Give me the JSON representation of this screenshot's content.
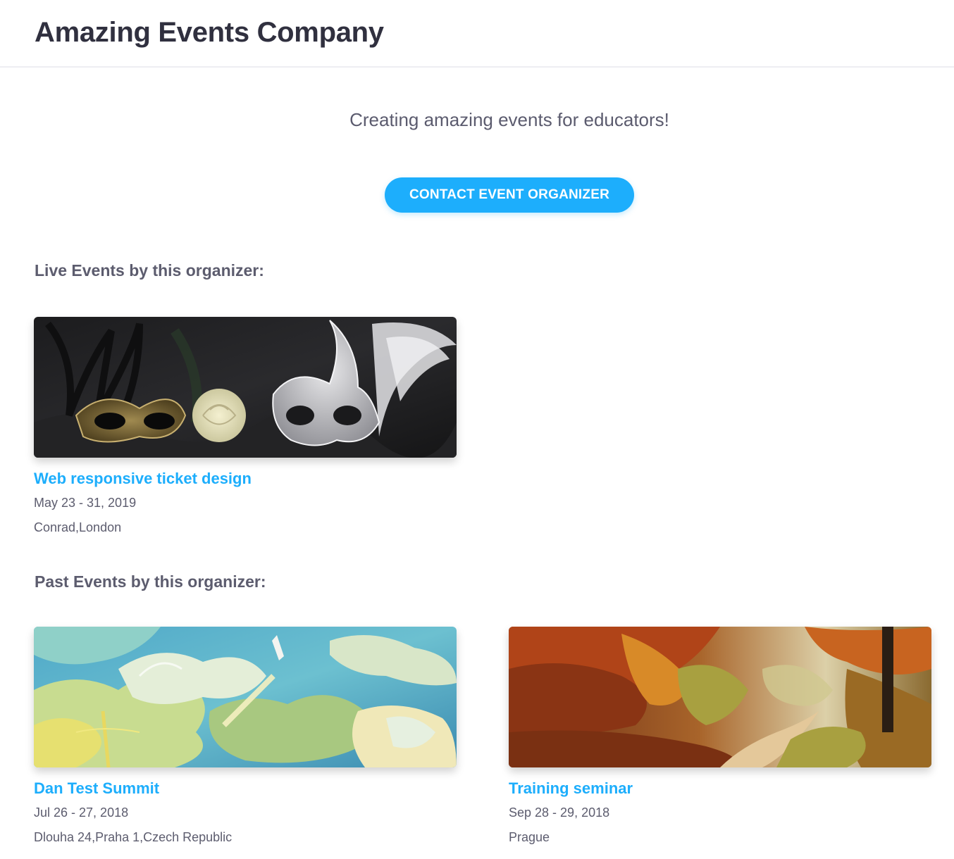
{
  "header": {
    "company_name": "Amazing Events Company"
  },
  "hero": {
    "tagline": "Creating amazing events for educators!",
    "contact_button_label": "CONTACT EVENT ORGANIZER"
  },
  "live_events": {
    "heading": "Live Events by this organizer:",
    "events": [
      {
        "title": "Web responsive ticket design",
        "dates": "May 23 - 31, 2019",
        "location": "Conrad,London",
        "image": "masquerade-masks-and-rose"
      }
    ]
  },
  "past_events": {
    "heading": "Past Events by this organizer:",
    "events": [
      {
        "title": "Dan Test Summit",
        "dates": "Jul 26 - 27, 2018",
        "location": "Dlouha 24,Praha 1,Czech Republic",
        "image": "painted-sky-with-rocket"
      },
      {
        "title": "Training seminar",
        "dates": "Sep 28 - 29, 2018",
        "location": "Prague",
        "image": "autumn-forest-path"
      }
    ]
  },
  "colors": {
    "accent": "#1daefc",
    "heading_text": "#30303f",
    "body_text": "#5c5c6e"
  }
}
